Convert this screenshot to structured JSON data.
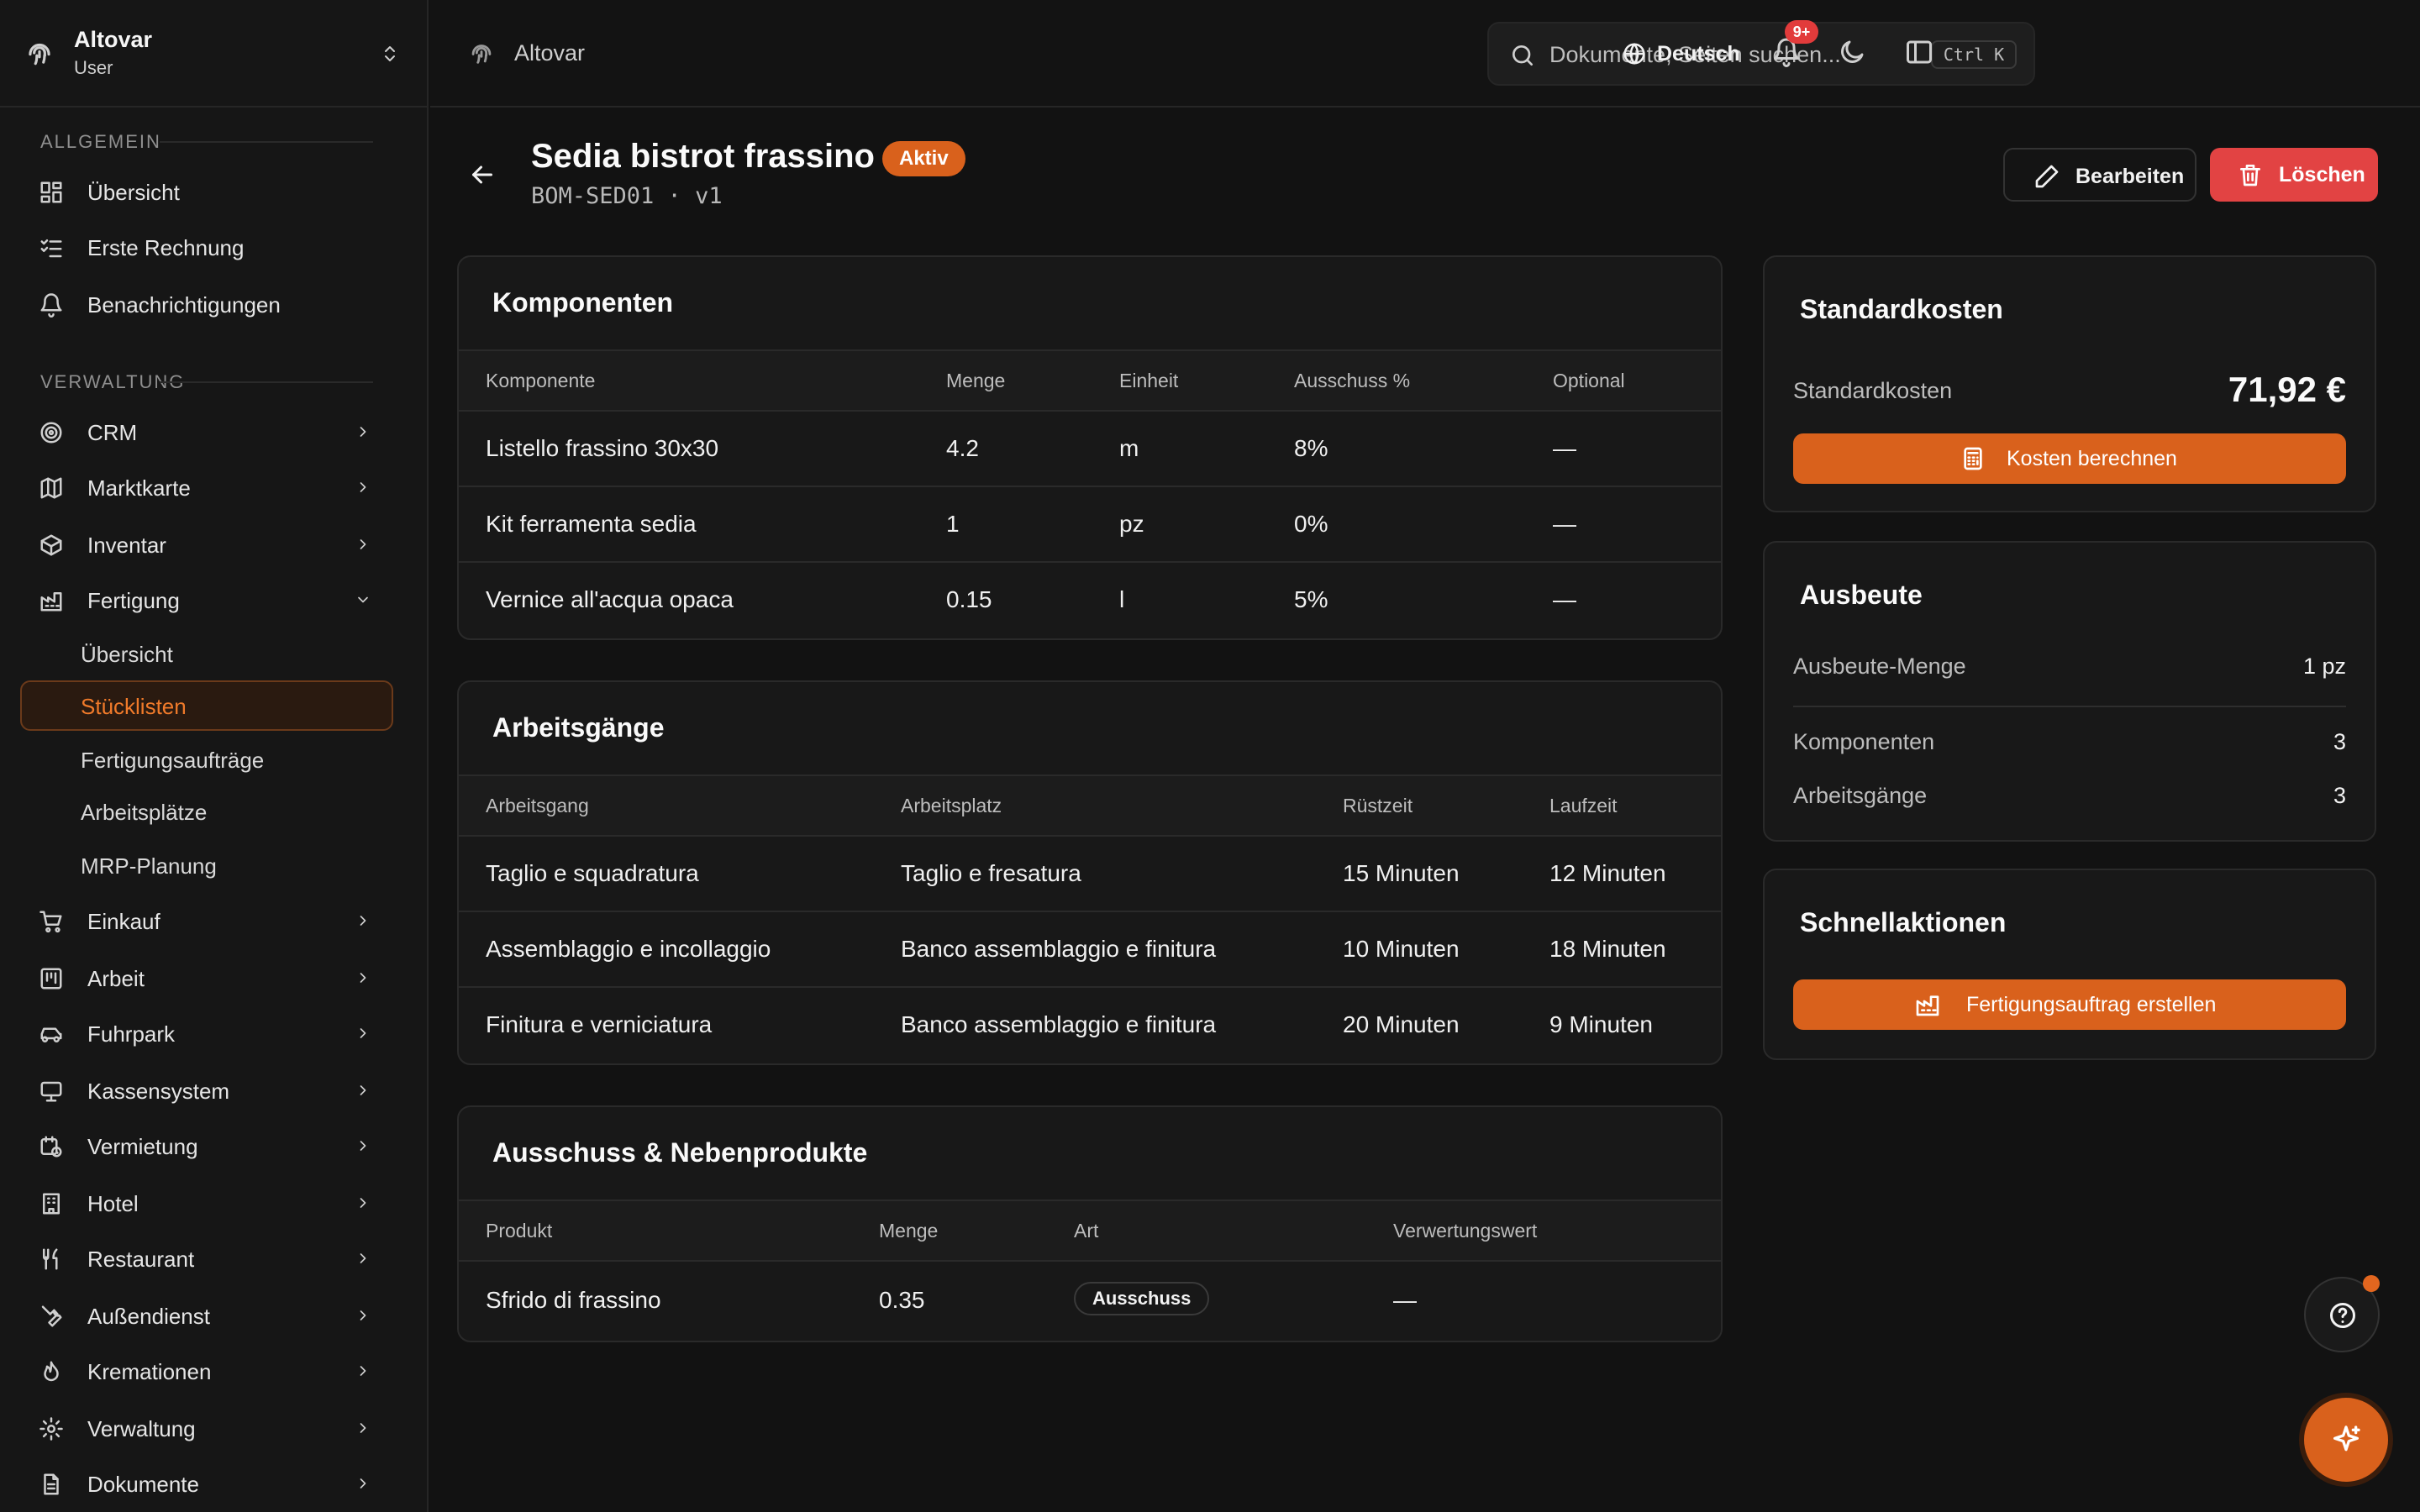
{
  "brand": {
    "name": "Altovar",
    "role": "User"
  },
  "header": {
    "title": "Altovar",
    "search_placeholder": "Dokumente, Seiten suchen...",
    "search_shortcut": "Ctrl K",
    "language": "Deutsch",
    "notifications_badge": "9+"
  },
  "sidebar": {
    "section_general": "ALLGEMEIN",
    "general_items": [
      {
        "label": "Übersicht",
        "icon": "dashboard-icon"
      },
      {
        "label": "Erste Rechnung",
        "icon": "checklist-icon"
      },
      {
        "label": "Benachrichtigungen",
        "icon": "bell-icon"
      }
    ],
    "section_admin": "VERWALTUNG",
    "admin_items": [
      {
        "label": "CRM",
        "icon": "target-icon"
      },
      {
        "label": "Marktkarte",
        "icon": "map-icon"
      },
      {
        "label": "Inventar",
        "icon": "box-icon"
      },
      {
        "label": "Fertigung",
        "icon": "factory-icon",
        "expanded": true
      }
    ],
    "fertigung_sub": [
      {
        "label": "Übersicht"
      },
      {
        "label": "Stücklisten",
        "active": true
      },
      {
        "label": "Fertigungsaufträge"
      },
      {
        "label": "Arbeitsplätze"
      },
      {
        "label": "MRP-Planung"
      }
    ],
    "more_items": [
      {
        "label": "Einkauf",
        "icon": "cart-icon"
      },
      {
        "label": "Arbeit",
        "icon": "kanban-icon"
      },
      {
        "label": "Fuhrpark",
        "icon": "car-icon"
      },
      {
        "label": "Kassensystem",
        "icon": "monitor-icon"
      },
      {
        "label": "Vermietung",
        "icon": "calendar-clock-icon"
      },
      {
        "label": "Hotel",
        "icon": "building-icon"
      },
      {
        "label": "Restaurant",
        "icon": "utensils-icon"
      },
      {
        "label": "Außendienst",
        "icon": "wrench-icon"
      },
      {
        "label": "Kremationen",
        "icon": "flame-icon"
      },
      {
        "label": "Verwaltung",
        "icon": "gear-icon"
      },
      {
        "label": "Dokumente",
        "icon": "document-icon"
      }
    ]
  },
  "page": {
    "title": "Sedia bistrot frassino",
    "status": "Aktiv",
    "subtitle": "BOM-SED01 · v1",
    "edit_label": "Bearbeiten",
    "delete_label": "Löschen"
  },
  "components": {
    "title": "Komponenten",
    "columns": [
      "Komponente",
      "Menge",
      "Einheit",
      "Ausschuss %",
      "Optional"
    ],
    "rows": [
      [
        "Listello frassino 30x30",
        "4.2",
        "m",
        "8%",
        "—"
      ],
      [
        "Kit ferramenta sedia",
        "1",
        "pz",
        "0%",
        "—"
      ],
      [
        "Vernice all'acqua opaca",
        "0.15",
        "l",
        "5%",
        "—"
      ]
    ]
  },
  "operations": {
    "title": "Arbeitsgänge",
    "columns": [
      "Arbeitsgang",
      "Arbeitsplatz",
      "Rüstzeit",
      "Laufzeit"
    ],
    "rows": [
      [
        "Taglio e squadratura",
        "Taglio e fresatura",
        "15 Minuten",
        "12 Minuten"
      ],
      [
        "Assemblaggio e incollaggio",
        "Banco assemblaggio e finitura",
        "10 Minuten",
        "18 Minuten"
      ],
      [
        "Finitura e verniciatura",
        "Banco assemblaggio e finitura",
        "20 Minuten",
        "9 Minuten"
      ]
    ]
  },
  "scrap": {
    "title": "Ausschuss & Nebenprodukte",
    "columns": [
      "Produkt",
      "Menge",
      "Art",
      "Verwertungswert"
    ],
    "rows": [
      [
        "Sfrido di frassino",
        "0.35",
        "Ausschuss",
        "—"
      ]
    ]
  },
  "standard_cost": {
    "title": "Standardkosten",
    "label": "Standardkosten",
    "value": "71,92 €",
    "button": "Kosten berechnen"
  },
  "yield": {
    "title": "Ausbeute",
    "qty_label": "Ausbeute-Menge",
    "qty_value": "1 pz",
    "components_label": "Komponenten",
    "components_value": "3",
    "operations_label": "Arbeitsgänge",
    "operations_value": "3"
  },
  "quick_actions": {
    "title": "Schnellaktionen",
    "button": "Fertigungsauftrag erstellen"
  },
  "colors": {
    "accent": "#d9611c",
    "danger": "#e24343",
    "background": "#121212"
  }
}
